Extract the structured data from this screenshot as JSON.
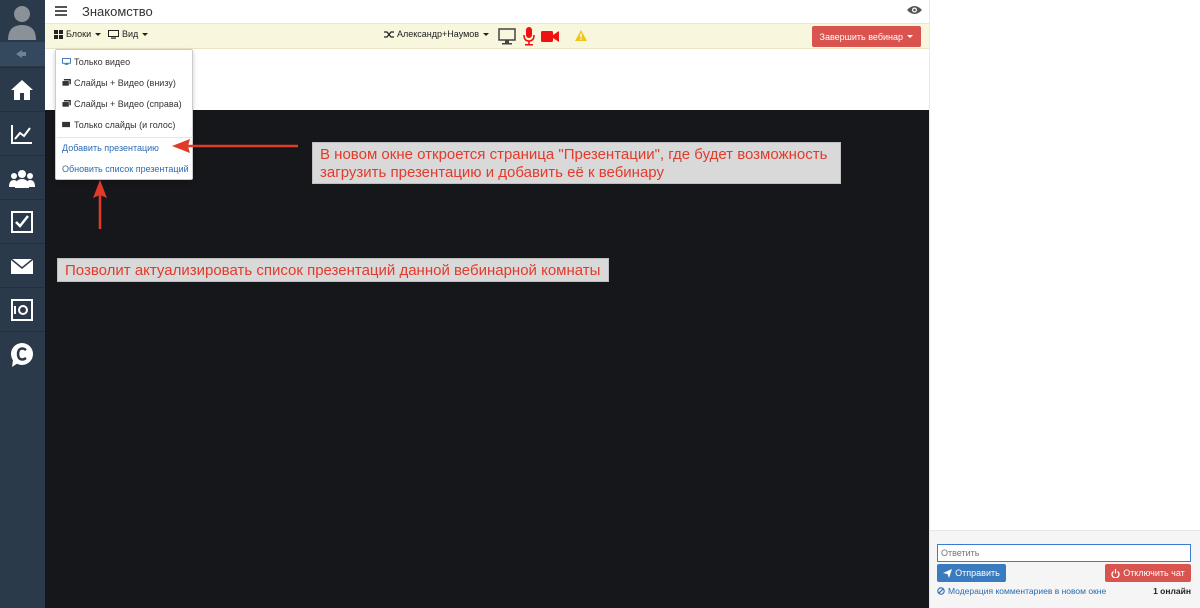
{
  "window": {
    "title": "Знакомство"
  },
  "toolbar": {
    "blocks_label": "Блоки",
    "view_label": "Вид",
    "presenter_label": "Александр+Наумов",
    "end_label": "Завершить вебинар"
  },
  "dropdown": {
    "items": [
      {
        "label": "Только видео",
        "icon": "monitor-icon"
      },
      {
        "label": "Слайды + Видео (внизу)",
        "icon": "slides-icon"
      },
      {
        "label": "Слайды + Видео (справа)",
        "icon": "slides-icon"
      },
      {
        "label": "Только слайды (и голос)",
        "icon": "slides-only-icon"
      }
    ],
    "links": [
      {
        "label": "Добавить презентацию"
      },
      {
        "label": "Обновить список презентаций"
      }
    ]
  },
  "annotations": {
    "add_note_line1": "В новом окне откроется страница \"Презентации\", где будет возможность",
    "add_note_line2": "загрузить презентацию и добавить её к вебинару",
    "refresh_note": "Позволит актуализировать список презентаций данной вебинарной комнаты"
  },
  "chat": {
    "reply_placeholder": "Ответить",
    "send_label": "Отправить",
    "disable_label": "Отключить чат",
    "moderation_link": "Модерация комментариев в новом окне",
    "online_count": "1 онлайн"
  },
  "colors": {
    "sidebar": "#2b3a4a",
    "toolbar": "#f8f6dd",
    "danger": "#d9534f",
    "primary": "#3a7bbf",
    "note_text": "#e33a2b",
    "stage": "#16171a"
  }
}
